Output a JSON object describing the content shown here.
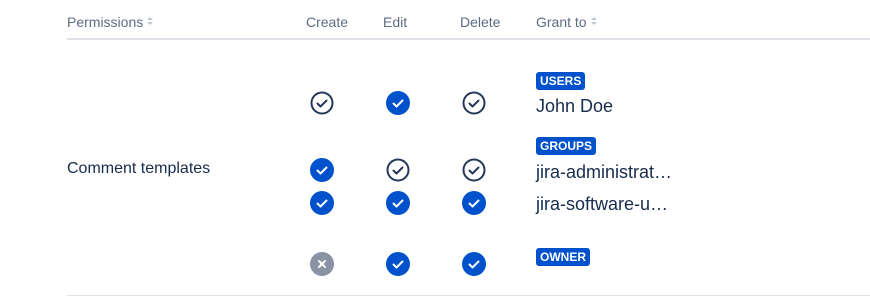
{
  "header": {
    "permissions": "Permissions",
    "create": "Create",
    "edit": "Edit",
    "delete": "Delete",
    "grant_to": "Grant to"
  },
  "row": {
    "permission": "Comment templates",
    "grants": [
      {
        "badge": "USERS",
        "name": "John Doe",
        "create": "granted-outline",
        "edit": "granted",
        "delete": "granted-outline"
      },
      {
        "badge": "GROUPS",
        "name": "jira-administrat…",
        "create": "granted",
        "edit": "granted-outline",
        "delete": "granted-outline"
      },
      {
        "badge": "",
        "name": "jira-software-u…",
        "create": "granted",
        "edit": "granted",
        "delete": "granted"
      },
      {
        "badge": "OWNER",
        "name": "",
        "create": "denied",
        "edit": "granted",
        "delete": "granted"
      }
    ]
  },
  "colors": {
    "accent": "#0052cc",
    "denied": "#8993a4",
    "outline": "#253858"
  }
}
